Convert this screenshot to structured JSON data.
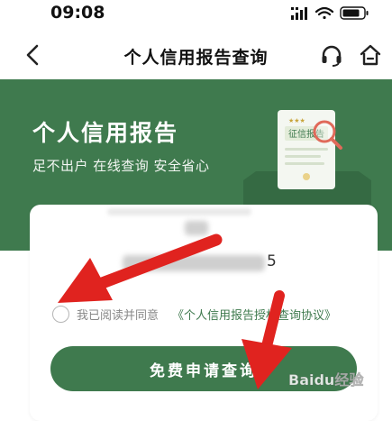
{
  "status_bar": {
    "time": "09:08"
  },
  "nav": {
    "title": "个人信用报告查询"
  },
  "banner": {
    "title": "个人信用报告",
    "subtitle": "足不出户 在线查询 安全省心",
    "illustration_label": "征信报告"
  },
  "form": {
    "id_number_visible_tail": "5",
    "agreement": {
      "checked": false,
      "prefix": "我已阅读并同意",
      "link": "《个人信用报告授权查询协议》"
    },
    "submit_label": "免费申请查询"
  },
  "watermark": {
    "text": "Baidu经验"
  },
  "colors": {
    "brand_green": "#3f7a4e",
    "arrow_red": "#e0231f"
  }
}
